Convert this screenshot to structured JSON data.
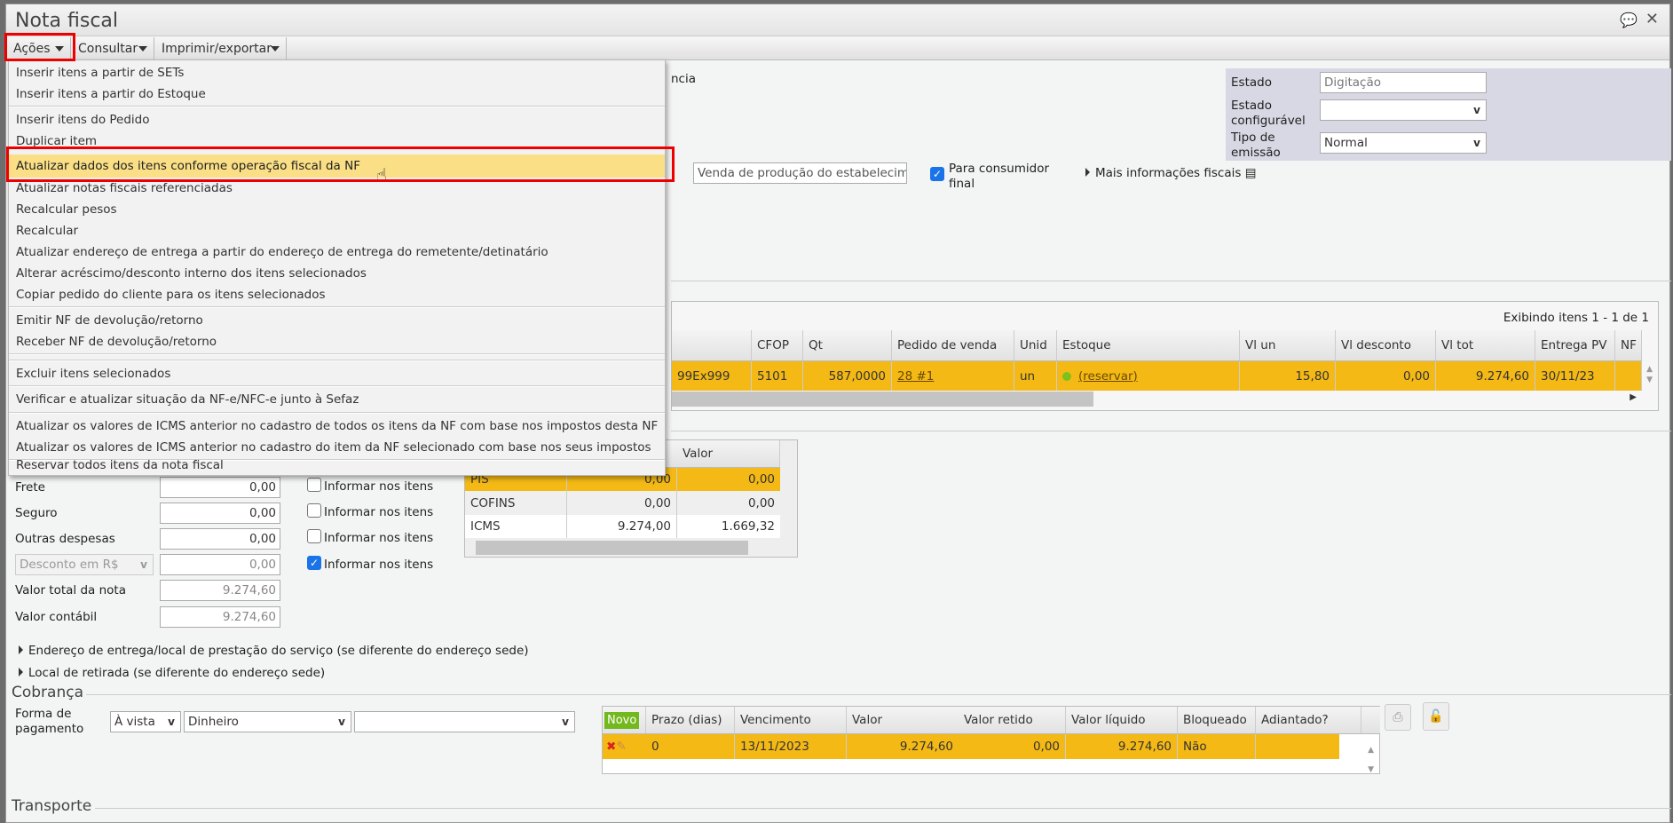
{
  "window": {
    "title": "Nota fiscal"
  },
  "toolbar": {
    "acoes": "Ações",
    "consultar": "Consultar",
    "imprimir": "Imprimir/exportar"
  },
  "menu": {
    "items": [
      "Inserir itens a partir de SETs",
      "Inserir itens a partir do Estoque",
      "Inserir itens do Pedido",
      "Duplicar item",
      "Atualizar dados dos itens conforme operação fiscal da NF",
      "Atualizar notas fiscais referenciadas",
      "Recalcular pesos",
      "Recalcular",
      "Atualizar endereço de entrega a partir do endereço de entrega do remetente/detinatário",
      "Alterar acréscimo/desconto interno dos itens selecionados",
      "Copiar pedido do cliente para os itens selecionados",
      "Emitir NF de devolução/retorno",
      "Receber NF de devolução/retorno",
      "Excluir itens selecionados",
      "Verificar e atualizar situação da NF-e/NFC-e junto à Sefaz",
      "Atualizar os valores de ICMS anterior no cadastro de todos os itens da NF com base nos impostos desta NF",
      "Atualizar os valores de ICMS anterior no cadastro do item da NF selecionado com base nos seus impostos",
      "Reservar todos itens da nota fiscal"
    ]
  },
  "header": {
    "partial_label": "ncia",
    "estado_label": "Estado",
    "estado_value": "Digitação",
    "estado_conf_label": "Estado configurável",
    "estado_conf_value": "",
    "tipo_label": "Tipo de emissão",
    "tipo_value": "Normal",
    "natureza_value": "Venda de produção do estabelecime",
    "consumidor_label": "Para consumidor final",
    "mais_info": "Mais informações fiscais"
  },
  "items": {
    "showing": "Exibindo itens 1 - 1 de 1",
    "columns": [
      "CFOP",
      "Qt",
      "Pedido de venda",
      "Unid",
      "Estoque",
      "Vl un",
      "Vl desconto",
      "Vl tot",
      "Entrega PV",
      "NF"
    ],
    "rows": [
      {
        "code": "99Ex999",
        "cfop": "5101",
        "qt": "587,0000",
        "pedido": "28 #1",
        "unid": "un",
        "estoque": "(reservar)",
        "vl_un": "15,80",
        "vl_desc": "0,00",
        "vl_tot": "9.274,60",
        "entrega": "30/11/23",
        "nf": ""
      }
    ]
  },
  "taxes": {
    "header_valor": "Valor",
    "rows": [
      {
        "name": "PIS",
        "base": "0,00",
        "valor": "0,00"
      },
      {
        "name": "COFINS",
        "base": "0,00",
        "valor": "0,00"
      },
      {
        "name": "ICMS",
        "base": "9.274,00",
        "valor": "1.669,32"
      }
    ]
  },
  "totals": {
    "frete_label": "Frete",
    "frete": "0,00",
    "seguro_label": "Seguro",
    "seguro": "0,00",
    "outras_label": "Outras despesas",
    "outras": "0,00",
    "desconto_type": "Desconto em R$",
    "desconto": "0,00",
    "total_label": "Valor total da nota",
    "total": "9.274,60",
    "contabil_label": "Valor contábil",
    "contabil": "9.274,60",
    "informar": "Informar nos itens"
  },
  "links": {
    "entrega": "Endereço de entrega/local de prestação do serviço (se diferente do endereço sede)",
    "retirada": "Local de retirada (se diferente do endereço sede)"
  },
  "cobranca": {
    "title": "Cobrança",
    "forma_label": "Forma de pagamento",
    "forma1": "À vista",
    "forma2": "Dinheiro",
    "forma3": "",
    "novo": "Novo",
    "columns": [
      "Prazo (dias)",
      "Vencimento",
      "Valor",
      "Valor retido",
      "Valor líquido",
      "Bloqueado",
      "Adiantado?"
    ],
    "rows": [
      {
        "prazo": "0",
        "venc": "13/11/2023",
        "valor": "9.274,60",
        "retido": "0,00",
        "liquido": "9.274,60",
        "bloqueado": "Não",
        "adiantado": ""
      }
    ]
  },
  "transporte": {
    "title": "Transporte"
  }
}
